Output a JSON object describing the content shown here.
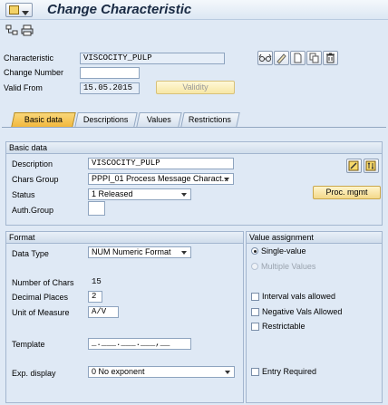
{
  "window": {
    "title": "Change Characteristic"
  },
  "header": {
    "characteristic_label": "Characteristic",
    "characteristic_value": "VISCOCITY_PULP",
    "change_number_label": "Change Number",
    "change_number_value": "",
    "valid_from_label": "Valid From",
    "valid_from_value": "15.05.2015",
    "validity_button": "Validity"
  },
  "tabs": [
    {
      "label": "Basic data"
    },
    {
      "label": "Descriptions"
    },
    {
      "label": "Values"
    },
    {
      "label": "Restrictions"
    }
  ],
  "basic_data": {
    "title": "Basic data",
    "description_label": "Description",
    "description_value": "VISCOCITY_PULP",
    "chars_group_label": "Chars Group",
    "chars_group_value": "PPPI_01 Process Message Charact...",
    "status_label": "Status",
    "status_value": "1 Released",
    "auth_group_label": "Auth.Group",
    "auth_group_value": "",
    "proc_mgmt_button": "Proc. mgmt"
  },
  "format": {
    "title": "Format",
    "data_type_label": "Data Type",
    "data_type_value": "NUM Numeric Format",
    "num_chars_label": "Number of Chars",
    "num_chars_value": "15",
    "decimal_places_label": "Decimal Places",
    "decimal_places_value": "2",
    "unit_label": "Unit of Measure",
    "unit_value": "A/V",
    "template_label": "Template",
    "template_value": "_.___.___.___,__",
    "exp_display_label": "Exp. display",
    "exp_display_value": "0 No exponent"
  },
  "value_assignment": {
    "title": "Value assignment",
    "single_value": "Single-value",
    "multiple_values": "Multiple Values",
    "interval_vals": "Interval vals allowed",
    "negative_vals": "Negative Vals Allowed",
    "restrictable": "Restrictable",
    "entry_required": "Entry Required"
  }
}
